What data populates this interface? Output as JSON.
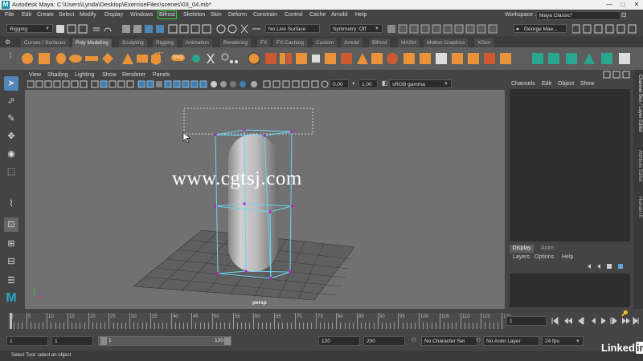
{
  "window": {
    "title": "Autodesk Maya: C:\\Users\\Lynda\\Desktop\\ExerciseFiles\\scenes\\03_04.mb*",
    "app_icon_letter": "M",
    "buttons": [
      "—",
      "□",
      "✕"
    ]
  },
  "menubar": {
    "items": [
      "File",
      "Edit",
      "Create",
      "Select",
      "Modify",
      "Display",
      "Windows",
      "Bifrost",
      "Skeleton",
      "Skin",
      "Deform",
      "Constrain",
      "Control",
      "Cache",
      "Arnold",
      "Help"
    ],
    "workspace_label": "Workspace :",
    "workspace_value": "Maya Classic*"
  },
  "statusline": {
    "mode": "Rigging",
    "live_surface": "No Live Surface",
    "symmetry": "Symmetry: Off",
    "user": "George Mae..."
  },
  "shelf": {
    "tabs": [
      "Curves / Surfaces",
      "Poly Modeling",
      "Sculpting",
      "Rigging",
      "Animation",
      "Rendering",
      "FX",
      "FX Caching",
      "Custom",
      "Arnold",
      "Bifrost",
      "MASH",
      "Motion Graphics",
      "XGen"
    ],
    "active_tab": "Poly Modeling",
    "text_tool": "T",
    "svg_tool": "SVG"
  },
  "viewport": {
    "menu": [
      "View",
      "Shading",
      "Lighting",
      "Show",
      "Renderer",
      "Panels"
    ],
    "exposure": "0.00",
    "gamma": "1.00",
    "color_space": "sRGB gamma",
    "camera_label": "persp",
    "watermark": "www.cgtsj.com"
  },
  "channelbox": {
    "menu": [
      "Channels",
      "Edit",
      "Object",
      "Show"
    ],
    "layer_tabs": [
      "Display",
      "Anim"
    ],
    "layer_menu": [
      "Layers",
      "Options",
      "Help"
    ],
    "side_tabs": [
      "Channel Box / Layer Editor",
      "Attribute Editor",
      "Human IK"
    ]
  },
  "timeslider": {
    "ticks": [
      "1",
      "5",
      "10",
      "15",
      "20",
      "25",
      "30",
      "35",
      "40",
      "45",
      "50",
      "55",
      "60",
      "65",
      "70",
      "75",
      "80",
      "85",
      "90",
      "95",
      "100",
      "105",
      "110",
      "115",
      "120"
    ],
    "current_frame": "1"
  },
  "rangeslider": {
    "start": "1",
    "playback_start": "1",
    "range_start": "1",
    "range_end": "120",
    "playback_end": "120",
    "end": "200",
    "character_set": "No Character Set",
    "anim_layer": "No Anim Layer",
    "fps": "24 fps"
  },
  "helpline": {
    "text": "Select Tool: select an object"
  },
  "branding": {
    "linkedin": "Linked",
    "linkedin_in": "in"
  },
  "colors": {
    "accent_blue": "#3d7fb0",
    "shelf_orange": "#e8923a",
    "shelf_teal": "#2aa58f",
    "cage_cyan": "#6ad6f0",
    "bifrost_green": "#2fd02f",
    "vertex_magenta": "#c417c4"
  }
}
